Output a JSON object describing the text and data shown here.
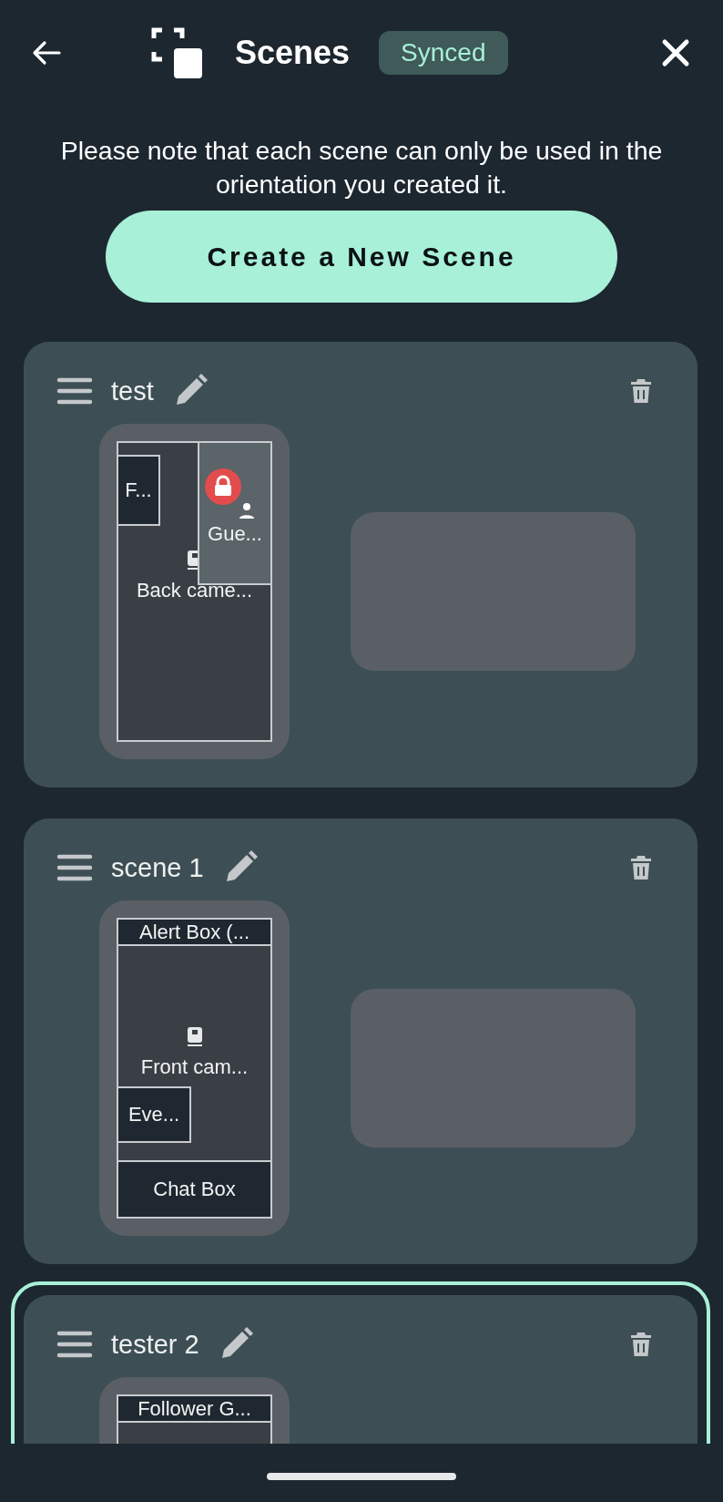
{
  "header": {
    "title": "Scenes",
    "status": "Synced"
  },
  "note": "Please note that each scene can only be used in the orientation you created it.",
  "create_button": "Create a New Scene",
  "scenes": [
    {
      "name": "test",
      "selected": false,
      "empty_slot": true,
      "layers": [
        {
          "label": "F...",
          "kind": "widget-top-left",
          "locked": false
        },
        {
          "label": "Gue...",
          "kind": "guest-top-right",
          "locked": true
        },
        {
          "label": "Back came...",
          "kind": "camera-full",
          "locked": false
        }
      ]
    },
    {
      "name": "scene 1",
      "selected": false,
      "empty_slot": true,
      "layers": [
        {
          "label": "Alert Box (...",
          "kind": "widget-top-strip",
          "locked": false
        },
        {
          "label": "Front cam...",
          "kind": "camera-full",
          "locked": false
        },
        {
          "label": "Eve...",
          "kind": "widget-lower-left",
          "locked": false
        },
        {
          "label": "Chat Box",
          "kind": "widget-bottom-strip",
          "locked": false
        }
      ]
    },
    {
      "name": "tester 2",
      "selected": true,
      "empty_slot": false,
      "layers": [
        {
          "label": "Follower G...",
          "kind": "widget-top-strip",
          "locked": false
        }
      ]
    }
  ]
}
